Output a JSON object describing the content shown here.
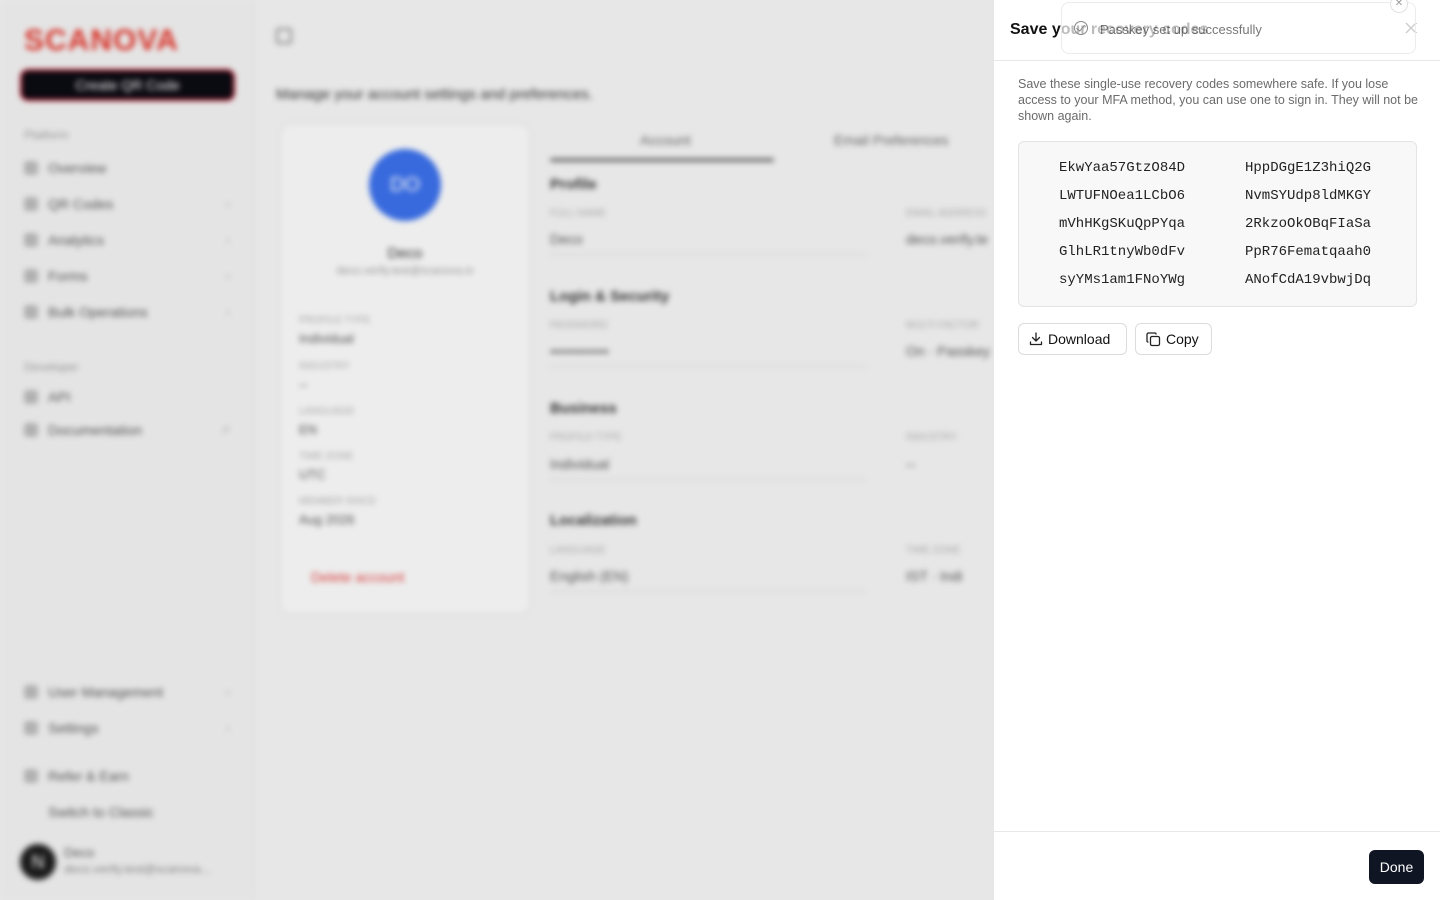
{
  "background": {
    "logo": "SCANOVA",
    "create_button": "Create QR Code",
    "sections": {
      "platform": "Platform",
      "developer": "Developer"
    },
    "nav": [
      "Overview",
      "QR Codes",
      "Analytics",
      "Forms",
      "Bulk Operations",
      "API",
      "Documentation",
      "User Management",
      "Settings",
      "Refer & Earn",
      "Switch to Classic"
    ],
    "user": {
      "avatar": "N",
      "name": "Deco",
      "email": "deco.verify.test@scanova..."
    },
    "page_subtitle": "Manage your account settings and preferences.",
    "profile": {
      "initials": "DO",
      "name": "Deco",
      "email": "deco.verify.test@scanova.io",
      "fields": [
        {
          "label": "PROFILE TYPE",
          "value": "Individual"
        },
        {
          "label": "INDUSTRY",
          "value": "--"
        },
        {
          "label": "LANGUAGE",
          "value": "EN"
        },
        {
          "label": "TIME ZONE",
          "value": "UTC"
        },
        {
          "label": "MEMBER SINCE",
          "value": "Aug 2026"
        }
      ],
      "delete": "Delete account"
    },
    "tabs": [
      "Account",
      "Email Preferences"
    ],
    "sections_main": [
      {
        "title": "Profile",
        "fields": [
          {
            "label": "FULL NAME",
            "value": "Deco"
          },
          {
            "label": "EMAIL ADDRESS",
            "value": "deco.verify.te"
          }
        ]
      },
      {
        "title": "Login & Security",
        "fields": [
          {
            "label": "PASSWORD",
            "value": "••••••••••••"
          },
          {
            "label": "MULTI-FACTOR",
            "value": "On · Passkey"
          }
        ]
      },
      {
        "title": "Business",
        "fields": [
          {
            "label": "PROFILE TYPE",
            "value": "Individual"
          },
          {
            "label": "INDUSTRY",
            "value": "--"
          }
        ]
      },
      {
        "title": "Localization",
        "fields": [
          {
            "label": "LANGUAGE",
            "value": "English (EN)"
          },
          {
            "label": "TIME ZONE",
            "value": "IST · Indi"
          }
        ]
      }
    ]
  },
  "sheet": {
    "title": "Save your recovery codes",
    "description": "Save these single-use recovery codes somewhere safe. If you lose access to your MFA method, you can use one to sign in. They will not be shown again.",
    "codes": [
      [
        "EkwYaa57GtzO84D",
        "HppDGgE1Z3hiQ2G"
      ],
      [
        "LWTUFNOea1LCbO6",
        "NvmSYUdp8ldMKGY"
      ],
      [
        "mVhHKgSKuQpPYqa",
        "2RkzoOkOBqFIaSa"
      ],
      [
        "GlhLR1tnyWb0dFv",
        "PpR76Fematqaah0"
      ],
      [
        "syYMs1am1FNoYWg",
        "ANofCdA19vbwjDq"
      ]
    ],
    "download_label": "Download",
    "copy_label": "Copy",
    "done_label": "Done"
  },
  "toast": {
    "message": "Passkey set up successfully"
  }
}
